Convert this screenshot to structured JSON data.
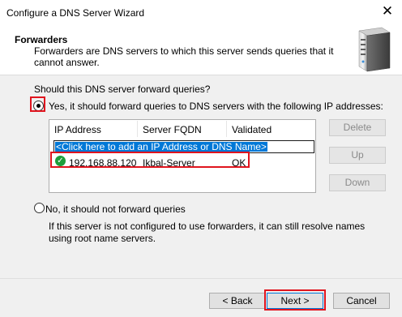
{
  "window": {
    "title": "Configure a DNS Server Wizard",
    "close_glyph": "✕"
  },
  "header": {
    "title": "Forwarders",
    "description": "Forwarders are DNS servers to which this server sends queries that it cannot answer.",
    "icon": "server-icon"
  },
  "question": "Should this DNS server forward queries?",
  "options": {
    "yes_label": "Yes, it should forward queries to DNS servers with the following IP addresses:",
    "yes_selected": true,
    "no_label": "No, it should not forward queries",
    "no_selected": false
  },
  "table": {
    "columns": [
      "IP Address",
      "Server FQDN",
      "Validated"
    ],
    "add_prompt": "<Click here to add an IP Address or DNS Name>",
    "rows": [
      {
        "status_icon": "check-circle-icon",
        "ip": "192.168.88.120",
        "fqdn": "Ikbal-Server",
        "validated": "OK"
      }
    ]
  },
  "side_buttons": {
    "delete": "Delete",
    "up": "Up",
    "down": "Down"
  },
  "note": "If this server is not configured to use forwarders, it can still resolve names using root name servers.",
  "footer": {
    "back": "< Back",
    "next": "Next >",
    "cancel": "Cancel"
  },
  "colors": {
    "highlight": "#e0141e",
    "selection": "#0078d7",
    "ok_green": "#1e9e3a"
  }
}
